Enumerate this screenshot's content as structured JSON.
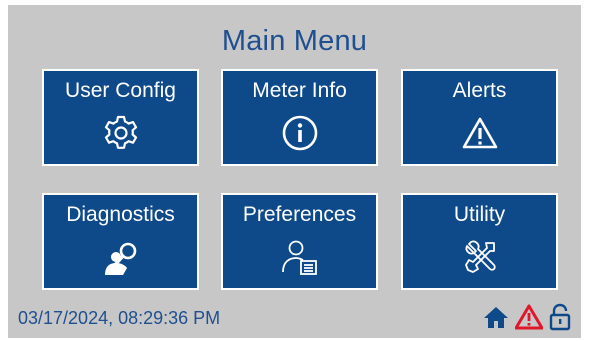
{
  "header": {
    "title": "Main Menu"
  },
  "tiles": [
    {
      "label": "User Config",
      "icon": "gear-icon"
    },
    {
      "label": "Meter Info",
      "icon": "info-icon"
    },
    {
      "label": "Alerts",
      "icon": "warning-icon"
    },
    {
      "label": "Diagnostics",
      "icon": "magnifier-person-icon"
    },
    {
      "label": "Preferences",
      "icon": "user-settings-icon"
    },
    {
      "label": "Utility",
      "icon": "tools-icon"
    }
  ],
  "status_bar": {
    "datetime": "03/17/2024, 08:29:36 PM",
    "icons": [
      "home-icon",
      "alert-icon",
      "unlock-icon"
    ]
  },
  "colors": {
    "tile_bg": "#0e4a8a",
    "title": "#1f4f8f",
    "screen_bg": "#c8c7c7",
    "alert": "#e0162b"
  }
}
